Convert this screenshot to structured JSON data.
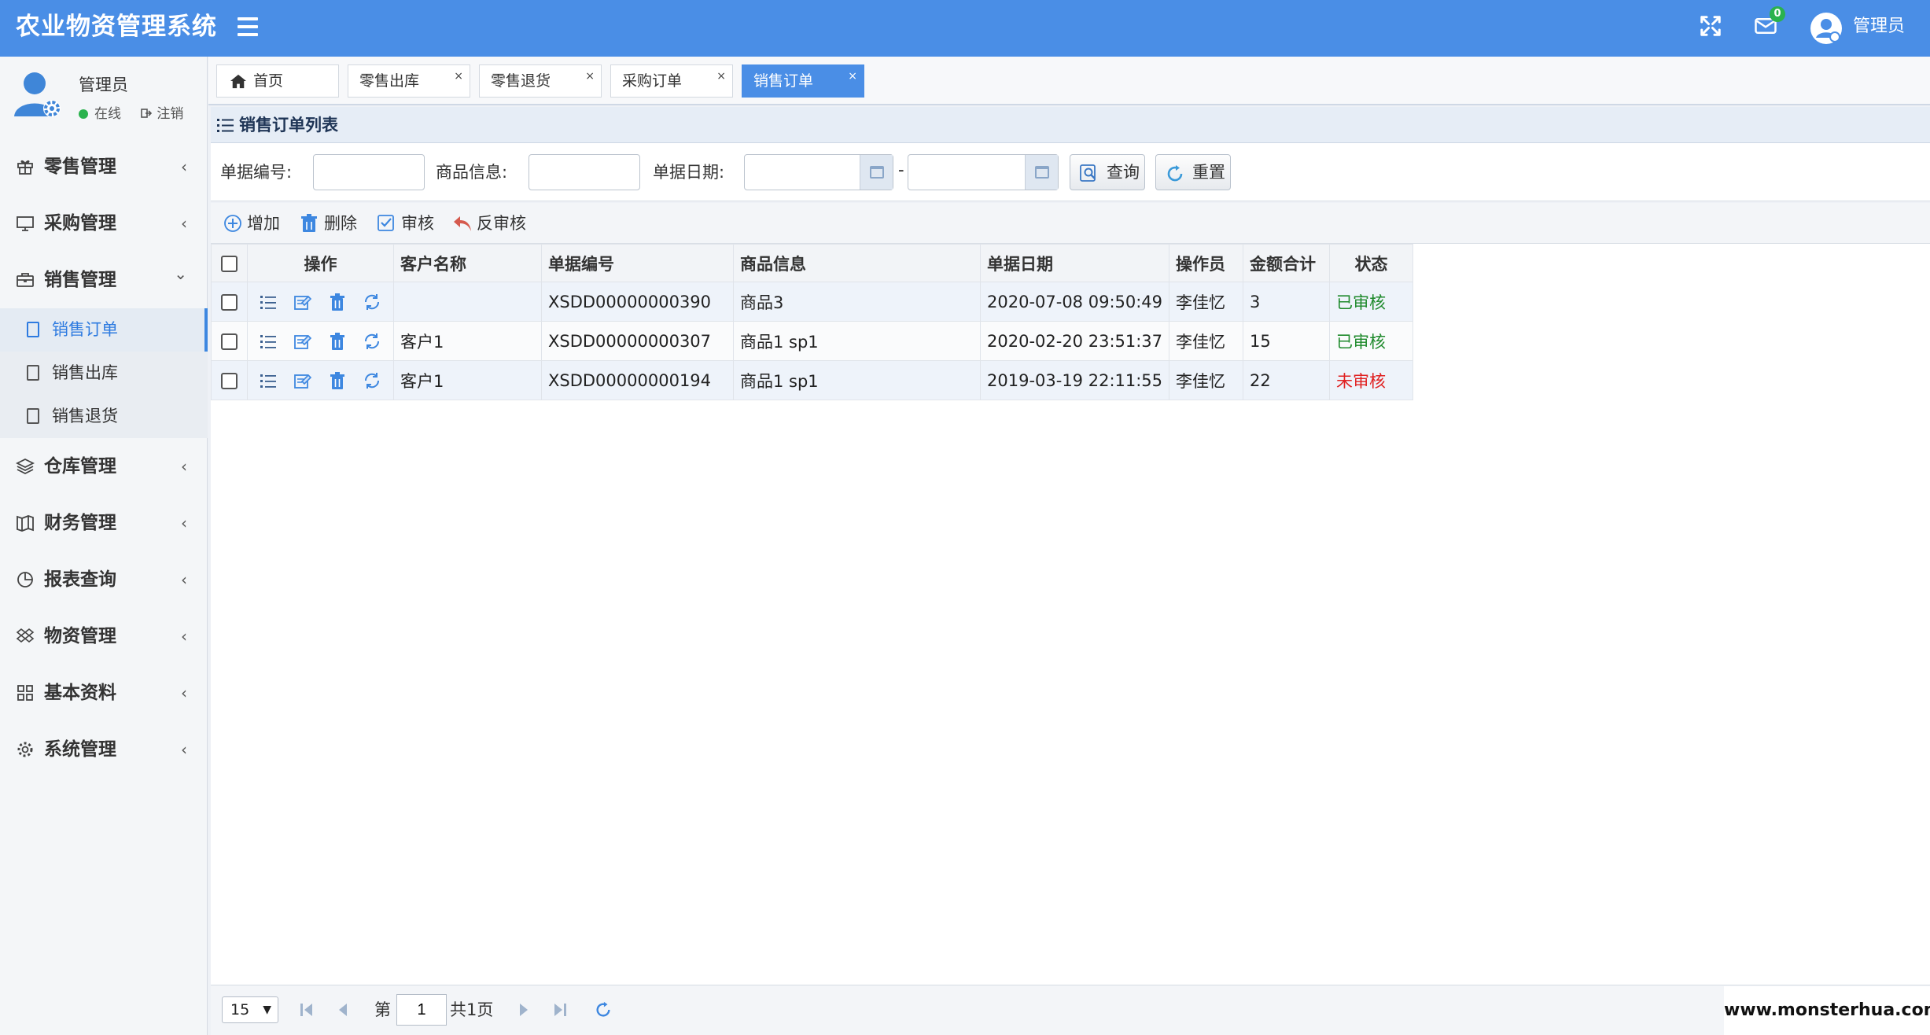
{
  "app": {
    "title": "农业物资管理系统",
    "colors": {
      "primary": "#4a8ee6",
      "success": "#1f8a2c",
      "danger": "#e02020",
      "online": "#2ab24d"
    }
  },
  "header": {
    "mail_count": "0",
    "user_name": "管理员",
    "icons": [
      "menu-icon",
      "fullscreen-icon",
      "mail-icon",
      "user-avatar-icon"
    ]
  },
  "sidebar": {
    "user": {
      "name": "管理员",
      "status": "在线",
      "logout": "注销"
    },
    "items": [
      {
        "label": "零售管理",
        "icon": "gift-icon",
        "chevron": "‹"
      },
      {
        "label": "采购管理",
        "icon": "monitor-icon",
        "chevron": "‹"
      },
      {
        "label": "销售管理",
        "icon": "briefcase-icon",
        "chevron": "⌄",
        "children": [
          {
            "label": "销售订单",
            "active": true
          },
          {
            "label": "销售出库"
          },
          {
            "label": "销售退货"
          }
        ]
      },
      {
        "label": "仓库管理",
        "icon": "layers-icon",
        "chevron": "‹"
      },
      {
        "label": "财务管理",
        "icon": "book-icon",
        "chevron": "‹"
      },
      {
        "label": "报表查询",
        "icon": "pie-chart-icon",
        "chevron": "‹"
      },
      {
        "label": "物资管理",
        "icon": "dropbox-icon",
        "chevron": "‹"
      },
      {
        "label": "基本资料",
        "icon": "grid-icon",
        "chevron": "‹"
      },
      {
        "label": "系统管理",
        "icon": "gear-icon",
        "chevron": "‹"
      }
    ]
  },
  "tabs": [
    {
      "label": "首页",
      "icon": "home-icon",
      "closable": false
    },
    {
      "label": "零售出库",
      "closable": true
    },
    {
      "label": "零售退货",
      "closable": true
    },
    {
      "label": "采购订单",
      "closable": true
    },
    {
      "label": "销售订单",
      "closable": true,
      "active": true
    }
  ],
  "tab_close_glyph": "×",
  "panel": {
    "title": "销售订单列表"
  },
  "search": {
    "bill_no_label": "单据编号:",
    "bill_no_value": "",
    "goods_label": "商品信息:",
    "goods_value": "",
    "date_label": "单据日期:",
    "date_from": "",
    "date_to": "",
    "dash": "-",
    "query_label": "查询",
    "reset_label": "重置"
  },
  "toolbar": {
    "add": "增加",
    "delete": "删除",
    "audit": "审核",
    "unaudit": "反审核"
  },
  "grid": {
    "columns": [
      "操作",
      "客户名称",
      "单据编号",
      "商品信息",
      "单据日期",
      "操作员",
      "金额合计",
      "状态"
    ],
    "rows": [
      {
        "customer": "",
        "bill_no": "XSDD00000000390",
        "goods": "商品3",
        "date": "2020-07-08 09:50:49",
        "operator": "李佳忆",
        "amount": "3",
        "status": "已审核",
        "audited": true
      },
      {
        "customer": "客户1",
        "bill_no": "XSDD00000000307",
        "goods": "商品1 sp1",
        "date": "2020-02-20 23:51:37",
        "operator": "李佳忆",
        "amount": "15",
        "status": "已审核",
        "audited": true
      },
      {
        "customer": "客户1",
        "bill_no": "XSDD00000000194",
        "goods": "商品1 sp1",
        "date": "2019-03-19 22:11:55",
        "operator": "李佳忆",
        "amount": "22",
        "status": "未审核",
        "audited": false
      }
    ],
    "row_action_icons": [
      "list-icon",
      "edit-icon",
      "trash-icon",
      "refresh-icon"
    ]
  },
  "pager": {
    "page_size": "15",
    "page_prefix": "第",
    "page": "1",
    "page_suffix": "共1页"
  },
  "watermark": "www.monsterhua.com"
}
